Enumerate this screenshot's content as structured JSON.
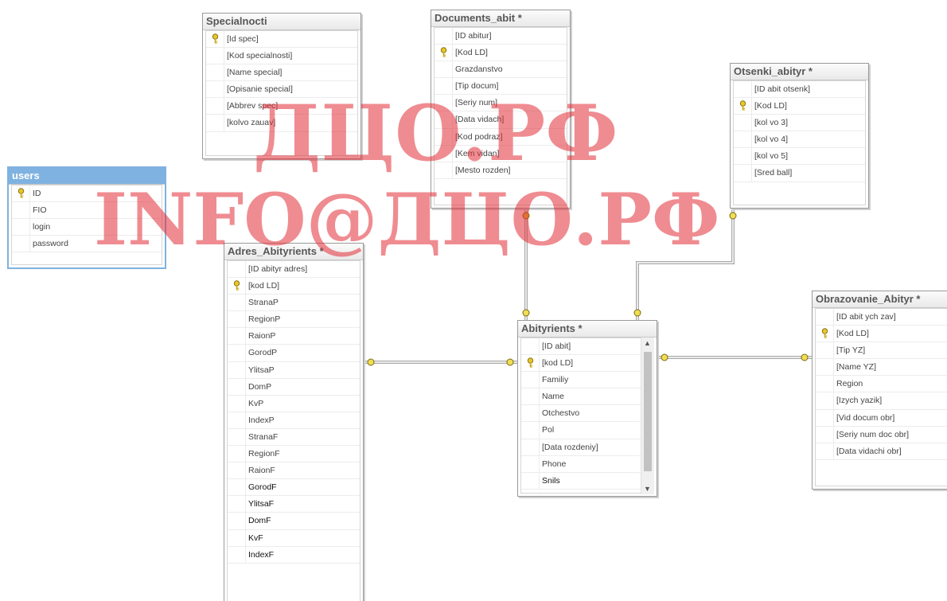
{
  "tables": {
    "users": {
      "title": "users",
      "rows": [
        {
          "name": "ID",
          "key": true
        },
        {
          "name": "FIO"
        },
        {
          "name": "login"
        },
        {
          "name": "password"
        }
      ]
    },
    "specialnocti": {
      "title": "Specialnocti",
      "rows": [
        {
          "name": "[Id spec]",
          "key": true
        },
        {
          "name": "[Kod specialnosti]"
        },
        {
          "name": "[Name special]"
        },
        {
          "name": "[Opisanie special]"
        },
        {
          "name": "[Abbrev spec]"
        },
        {
          "name": "[kolvo zauav]"
        }
      ]
    },
    "documents_abit": {
      "title": "Documents_abit *",
      "rows": [
        {
          "name": "[ID abitur]"
        },
        {
          "name": "[Kod LD]",
          "key": true
        },
        {
          "name": "Grazdanstvo"
        },
        {
          "name": "[Tip docum]"
        },
        {
          "name": "[Seriy num]"
        },
        {
          "name": "[Data vidach]"
        },
        {
          "name": "[Kod podraz]"
        },
        {
          "name": "[Kem vidan]"
        },
        {
          "name": "[Mesto rozden]"
        }
      ]
    },
    "otsenki_abityr": {
      "title": "Otsenki_abityr *",
      "rows": [
        {
          "name": "[ID abit otsenk]"
        },
        {
          "name": "[Kod LD]",
          "key": true
        },
        {
          "name": "[kol vo 3]"
        },
        {
          "name": "[kol vo 4]"
        },
        {
          "name": "[kol vo 5]"
        },
        {
          "name": "[Sred ball]"
        }
      ]
    },
    "adres_abityrients": {
      "title": "Adres_Abityrients *",
      "rows": [
        {
          "name": "[ID abityr adres]"
        },
        {
          "name": "[kod LD]",
          "key": true
        },
        {
          "name": "StranaP"
        },
        {
          "name": "RegionP"
        },
        {
          "name": "RaionP"
        },
        {
          "name": "GorodP"
        },
        {
          "name": "YlitsaP"
        },
        {
          "name": "DomP"
        },
        {
          "name": "KvP"
        },
        {
          "name": "IndexP"
        },
        {
          "name": "StranaF"
        },
        {
          "name": "RegionF"
        },
        {
          "name": "RaionF"
        },
        {
          "name": "GorodF",
          "dark": true
        },
        {
          "name": "YlitsaF",
          "dark": true
        },
        {
          "name": "DomF",
          "dark": true
        },
        {
          "name": "KvF",
          "dark": true
        },
        {
          "name": "IndexF",
          "dark": true
        }
      ]
    },
    "abityrients": {
      "title": "Abityrients *",
      "rows": [
        {
          "name": "[ID abit]"
        },
        {
          "name": "[kod LD]",
          "key": true
        },
        {
          "name": "Familiy"
        },
        {
          "name": "Name"
        },
        {
          "name": "Otchestvo"
        },
        {
          "name": "Pol"
        },
        {
          "name": "[Data rozdeniy]"
        },
        {
          "name": "Phone"
        },
        {
          "name": "Snils",
          "dark": true
        }
      ]
    },
    "obrazovanie_abityr": {
      "title": "Obrazovanie_Abityr *",
      "rows": [
        {
          "name": "[ID abit ych zav]"
        },
        {
          "name": "[Kod LD]",
          "key": true
        },
        {
          "name": "[Tip YZ]"
        },
        {
          "name": "[Name YZ]"
        },
        {
          "name": "Region"
        },
        {
          "name": "[Izych yazik]"
        },
        {
          "name": "[Vid docum obr]"
        },
        {
          "name": "[Seriy num doc obr]"
        },
        {
          "name": "[Data vidachi obr]"
        }
      ]
    }
  },
  "watermark": {
    "line1": "ДЦО.РФ",
    "line2": "INFO@ДЦО.РФ",
    "color": "#e12d37"
  },
  "icons": {
    "primary_key": "key-icon",
    "relation_end": "relationship-key-icon"
  },
  "colors": {
    "selected_title": "#7fb2e0",
    "title_text": "#575757",
    "border": "#9a9a9a"
  }
}
